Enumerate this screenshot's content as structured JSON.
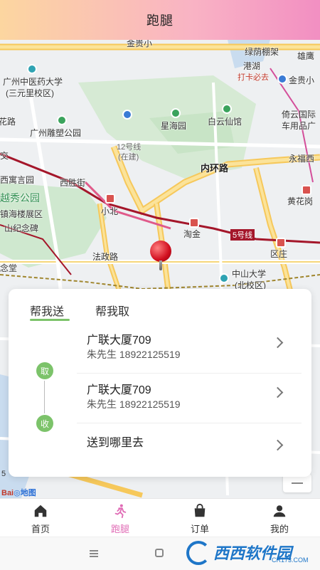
{
  "header": {
    "title": "跑腿"
  },
  "map": {
    "labels": {
      "jinxi": "金贵小",
      "rongjinluojia": "绿荫棚架",
      "chihu": "雄鹰",
      "gangwu": "港湖",
      "daka": "打卡必去",
      "univ": "广州中医药大学",
      "univ_campus": "(三元里校区)",
      "huali": "花路",
      "sculpture_park": "广州雕塑公园",
      "xinghaiyuan": "星海园",
      "baiyunxianguan": "白云仙馆",
      "yichengguo": "倚云国际",
      "carplace": "车用品广",
      "line12": "12号线",
      "line12_status": "(在建)",
      "neihuanlu": "内环路",
      "yongfu": "永福西",
      "jiao": "交",
      "ximogu": "西寓言园",
      "xishengjie": "西胜街",
      "huanghuagang": "黄花岗",
      "yuexiu_park": "越秀公园",
      "xiaobei": "小北",
      "zhenhailou": "镇海楼展区",
      "memorial": "山纪念碑",
      "taojin": "淘金",
      "line5": "5号线",
      "quzhuang": "区庄",
      "fazhenglu": "法政路",
      "zhongshan_univ": "中山大学",
      "north_campus": "(北校区)",
      "nian_tang": "念堂",
      "baiduditu": "地图"
    },
    "scale": "5"
  },
  "card": {
    "tabs": {
      "send": "帮我送",
      "fetch": "帮我取"
    },
    "badge_take": "取",
    "badge_receive": "收",
    "pickup": {
      "place": "广联大厦709",
      "contact": "朱先生 18922125519"
    },
    "receive": {
      "place": "广联大厦709",
      "contact": "朱先生 18922125519"
    },
    "destination": {
      "placeholder": "送到哪里去"
    }
  },
  "nav": {
    "items": [
      {
        "label": "首页",
        "icon": "home-icon"
      },
      {
        "label": "跑腿",
        "icon": "running-icon"
      },
      {
        "label": "订单",
        "icon": "bag-icon"
      },
      {
        "label": "我的",
        "icon": "user-icon"
      }
    ],
    "active_color": "#e06bb5"
  },
  "watermark": {
    "text": "西西软件园",
    "sub": "CR173.COM"
  }
}
